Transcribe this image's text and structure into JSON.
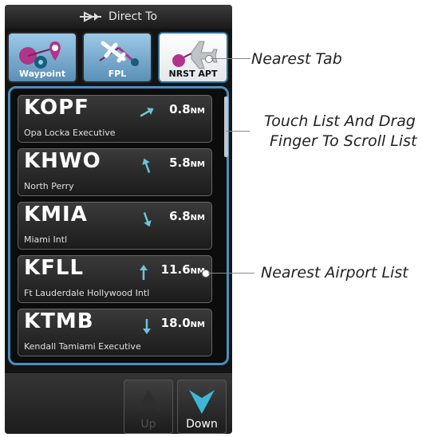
{
  "titlebar": {
    "title": "Direct To"
  },
  "tabs": [
    {
      "label": "Waypoint"
    },
    {
      "label": "FPL"
    },
    {
      "label": "NRST APT"
    }
  ],
  "airports": [
    {
      "ident": "KOPF",
      "name": "Opa Locka Executive",
      "distance": "0.8",
      "unit": "NM",
      "bearing_deg": 60
    },
    {
      "ident": "KHWO",
      "name": "North Perry",
      "distance": "5.8",
      "unit": "NM",
      "bearing_deg": -20
    },
    {
      "ident": "KMIA",
      "name": "Miami Intl",
      "distance": "6.8",
      "unit": "NM",
      "bearing_deg": 160
    },
    {
      "ident": "KFLL",
      "name": "Ft Lauderdale Hollywood Intl",
      "distance": "11.6",
      "unit": "NM",
      "bearing_deg": 0
    },
    {
      "ident": "KTMB",
      "name": "Kendall Tamiami Executive",
      "distance": "18.0",
      "unit": "NM",
      "bearing_deg": 180
    }
  ],
  "buttons": {
    "up": "Up",
    "down": "Down"
  },
  "callouts": {
    "nearest_tab": "Nearest Tab",
    "scroll_line1": "Touch List And Drag",
    "scroll_line2": "Finger To Scroll List",
    "airport_list": "Nearest Airport List"
  },
  "colors": {
    "accent": "#4a8fc0",
    "arrow": "#6ec3d8",
    "down_arrow": "#3fb6d6"
  }
}
